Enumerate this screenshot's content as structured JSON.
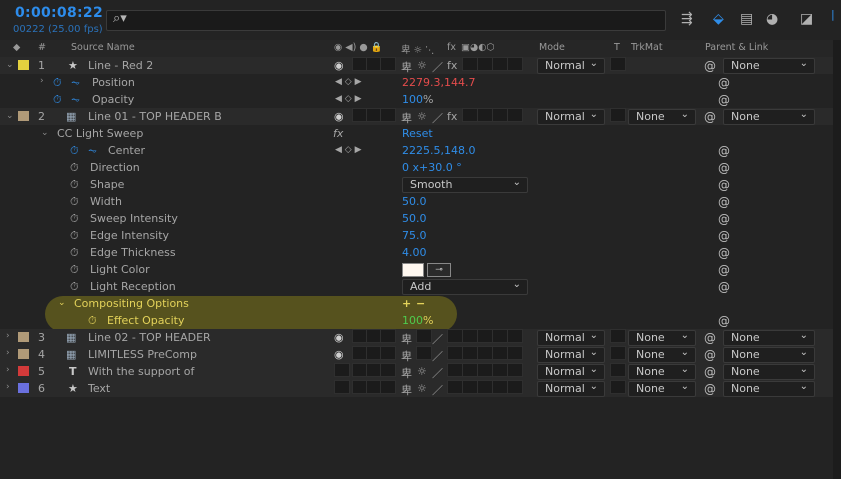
{
  "header": {
    "timecode": "0:00:08:22",
    "frame_info": "00222 (25.00 fps)",
    "search_placeholder": "",
    "search_icon": "search-icon",
    "toolbar_icons": [
      "composition-flowchart-icon",
      "draft-3d-icon",
      "frame-blending-icon",
      "motion-blur-icon",
      "graph-editor-icon"
    ]
  },
  "columns": {
    "label_icon": "tag-icon",
    "number": "#",
    "source_name": "Source Name",
    "switches": "switches",
    "fx": "fx",
    "mode": "Mode",
    "t": "T",
    "trkmat": "TrkMat",
    "parent": "Parent & Link"
  },
  "colors": {
    "accent_blue": "#2f8de8",
    "label_yellow": "#e3d13f",
    "label_tan": "#b09a78",
    "label_red": "#d23a3a",
    "label_periwinkle": "#6a70de",
    "highlight": "#b8b014"
  },
  "rows": {
    "layer1": {
      "num": "1",
      "name": "Line - Red 2",
      "mode": "Normal",
      "parent": "None",
      "icon": "shape-star-icon"
    },
    "l1_position": {
      "name": "Position",
      "value": "2279.3,144.7"
    },
    "l1_opacity": {
      "name": "Opacity",
      "value": "100",
      "unit": "%"
    },
    "layer2": {
      "num": "2",
      "name": "Line 01 - TOP HEADER B",
      "mode": "Normal",
      "trkmat": "None",
      "parent": "None",
      "icon": "precomp-icon"
    },
    "effect": {
      "name": "CC Light Sweep",
      "reset": "Reset"
    },
    "center": {
      "name": "Center",
      "value": "2225.5,148.0"
    },
    "direction": {
      "name": "Direction",
      "value": "0 x+30.0 °"
    },
    "shape": {
      "name": "Shape",
      "value": "Smooth"
    },
    "width": {
      "name": "Width",
      "value": "50.0"
    },
    "sweep_intensity": {
      "name": "Sweep Intensity",
      "value": "50.0"
    },
    "edge_intensity": {
      "name": "Edge Intensity",
      "value": "75.0"
    },
    "edge_thickness": {
      "name": "Edge Thickness",
      "value": "4.00"
    },
    "light_color": {
      "name": "Light Color",
      "value": "#fff8f0"
    },
    "light_reception": {
      "name": "Light Reception",
      "value": "Add"
    },
    "compositing": {
      "name": "Compositing Options",
      "plus": "+",
      "minus": "−"
    },
    "effect_opacity": {
      "name": "Effect Opacity",
      "value": "100",
      "unit": "%"
    },
    "layer3": {
      "num": "3",
      "name": "Line 02 - TOP HEADER",
      "mode": "Normal",
      "trkmat": "None",
      "parent": "None"
    },
    "layer4": {
      "num": "4",
      "name": "LIMITLESS PreComp",
      "mode": "Normal",
      "trkmat": "None",
      "parent": "None"
    },
    "layer5": {
      "num": "5",
      "name": "With the support of",
      "mode": "Normal",
      "trkmat": "None",
      "parent": "None",
      "icon": "text-layer-icon"
    },
    "layer6": {
      "num": "6",
      "name": "Text",
      "mode": "Normal",
      "trkmat": "None",
      "parent": "None",
      "icon": "shape-star-icon"
    }
  }
}
